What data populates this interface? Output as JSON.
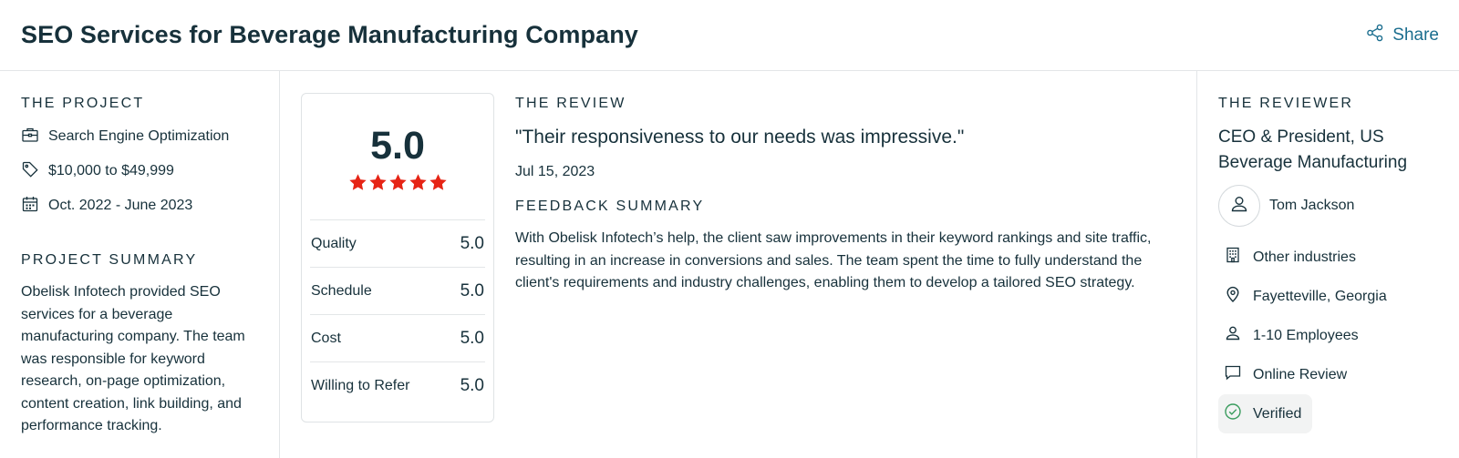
{
  "header": {
    "title": "SEO Services for Beverage Manufacturing Company",
    "share_label": "Share"
  },
  "project": {
    "section_label": "THE PROJECT",
    "service": "Search Engine Optimization",
    "budget": "$10,000 to $49,999",
    "dates": "Oct. 2022 - June 2023",
    "summary_label": "PROJECT SUMMARY",
    "summary": "Obelisk Infotech provided SEO services for a beverage manufacturing company. The team was responsible for keyword research, on-page optimization, content creation, link building, and performance tracking."
  },
  "rating": {
    "overall": "5.0",
    "stars": 5,
    "star_color": "#e62415",
    "rows": [
      {
        "label": "Quality",
        "value": "5.0"
      },
      {
        "label": "Schedule",
        "value": "5.0"
      },
      {
        "label": "Cost",
        "value": "5.0"
      },
      {
        "label": "Willing to Refer",
        "value": "5.0"
      }
    ]
  },
  "review": {
    "section_label": "THE REVIEW",
    "quote": "\"Their responsiveness to our needs was impressive.\"",
    "date": "Jul 15, 2023",
    "feedback_label": "FEEDBACK SUMMARY",
    "feedback": "With Obelisk Infotech’s help, the client saw improvements in their keyword rankings and site traffic, resulting in an increase in conversions and sales. The team spent the time to fully understand the client's requirements and industry challenges, enabling them to develop a tailored SEO strategy."
  },
  "reviewer": {
    "section_label": "THE REVIEWER",
    "title": "CEO & President, US Beverage Manufacturing",
    "name": "Tom Jackson",
    "industry": "Other industries",
    "location": "Fayetteville, Georgia",
    "employees": "1-10 Employees",
    "review_type": "Online Review",
    "verified": "Verified"
  },
  "icons": {
    "share": "share-icon",
    "service": "briefcase-icon",
    "budget": "price-tag-icon",
    "dates": "calendar-icon",
    "avatar": "user-icon",
    "industry": "building-icon",
    "location": "location-pin-icon",
    "employees": "person-icon",
    "review_type": "chat-bubble-icon",
    "verified": "check-circle-icon"
  },
  "colors": {
    "text": "#17313b",
    "link": "#1a6d8e",
    "star": "#e62415",
    "verified_check": "#3a9c5e"
  }
}
